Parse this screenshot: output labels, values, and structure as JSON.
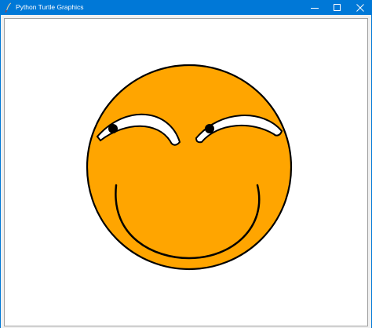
{
  "window": {
    "title": "Python Turtle Graphics",
    "accent_color": "#0078d7",
    "icons": {
      "app": "feather-pen-icon",
      "minimize": "minimize-icon",
      "maximize": "maximize-icon",
      "close": "close-icon"
    }
  },
  "drawing": {
    "face_color": "#ffa500",
    "outline_color": "#000000",
    "eye_white_color": "#ffffff",
    "pupil_color": "#000000"
  }
}
